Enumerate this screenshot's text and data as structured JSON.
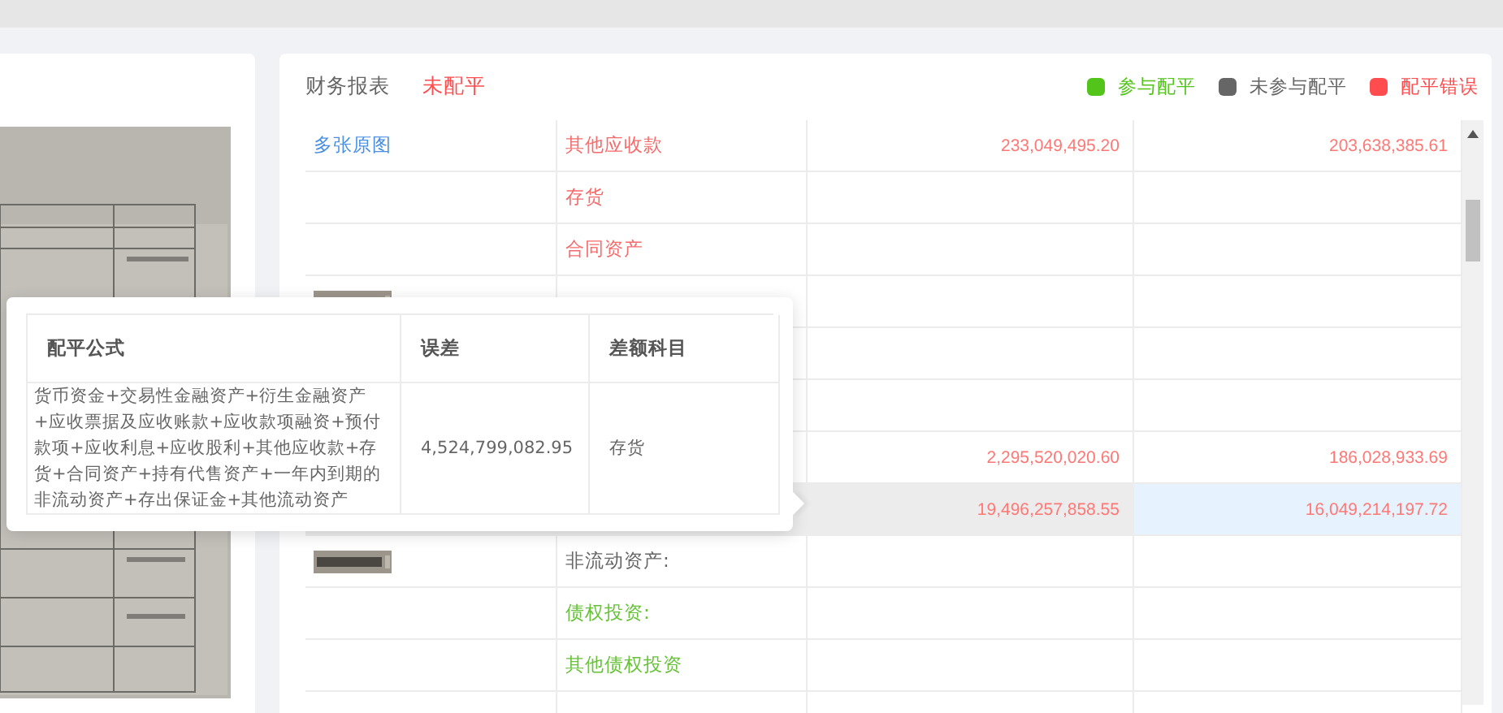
{
  "report": {
    "title": "财务报表",
    "status": "未配平"
  },
  "legend": [
    {
      "label": "参与配平",
      "color": "#52c41a"
    },
    {
      "label": "未参与配平",
      "color": "#666666"
    },
    {
      "label": "配平错误",
      "color": "#ff4d4f"
    }
  ],
  "table": {
    "rows": [
      {
        "source": {
          "kind": "link",
          "text": "多张原图"
        },
        "item": "其他应收款",
        "color": "#f56c6c",
        "value_1": "233,049,495.20",
        "value_2": "203,638,385.61",
        "selected": false
      },
      {
        "item": "存货",
        "color": "#f56c6c",
        "selected": false
      },
      {
        "item": "合同资产",
        "color": "#f56c6c",
        "selected": false
      },
      {
        "selected": false
      },
      {
        "selected": false
      },
      {
        "selected": false
      },
      {
        "value_1": "2,295,520,020.60",
        "value_2": "186,028,933.69",
        "selected": false
      },
      {
        "value_1": "19,496,257,858.55",
        "value_2": "16,049,214,197.72",
        "selected": true
      },
      {
        "item": "非流动资产:",
        "color": "#666666",
        "selected": false
      },
      {
        "item": "债权投资:",
        "color": "#67c23a",
        "selected": false
      },
      {
        "item": "其他债权投资",
        "color": "#67c23a",
        "selected": false
      },
      {
        "selected": false
      }
    ]
  },
  "popover": {
    "columns": [
      "配平公式",
      "误差",
      "差额科目"
    ],
    "rows": [
      {
        "formula": "货币资金+交易性金融资产+衍生金融资产+应收票据及应收账款+应收款项融资+预付款项+应收利息+应收股利+其他应收款+存货+合同资产+持有代售资产+一年内到期的非流动资产+存出保证金+其他流动资产",
        "difference": "4,524,799,082.95",
        "subject": "存货"
      }
    ]
  }
}
